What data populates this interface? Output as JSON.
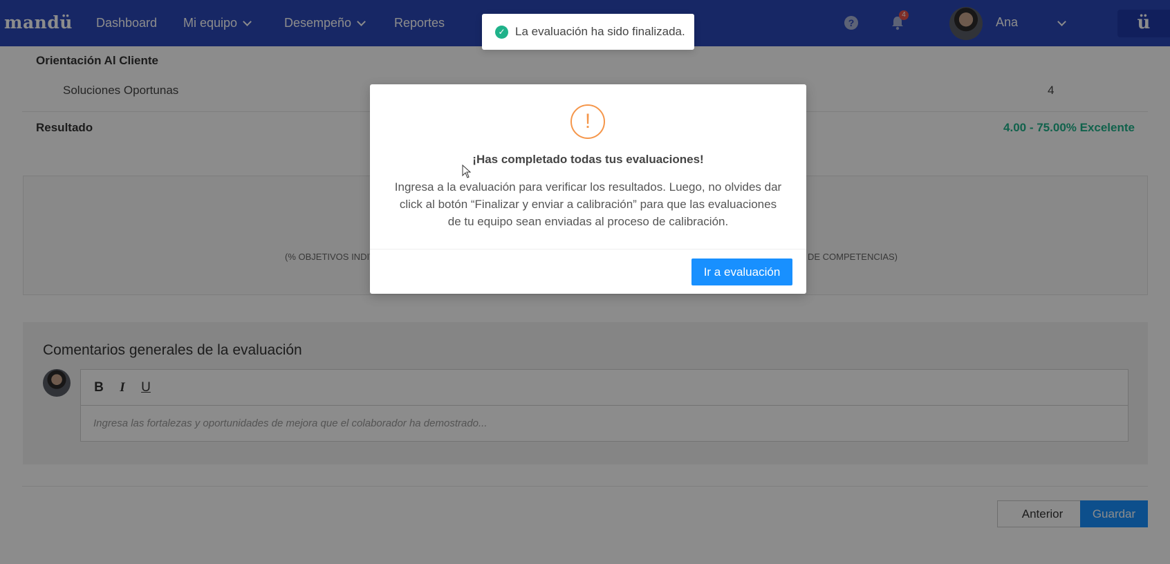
{
  "navbar": {
    "brand": "mandü",
    "items": [
      "Dashboard",
      "Mi equipo",
      "Desempeño",
      "Reportes"
    ],
    "help_icon": "question-circle-icon",
    "help_glyph": "?",
    "notifications_count": "4",
    "user_name": "Ana",
    "corner_logo": "ü"
  },
  "evaluation": {
    "section_title": "Orientación Al Cliente",
    "row_label": "Soluciones Oportunas",
    "row_score": "4",
    "result_label": "Resultado",
    "result_value": "4.00 - 75.00% Excelente",
    "summary_left": "(% OBJETIVOS INDIV",
    "summary_right": "DE COMPETENCIAS)"
  },
  "comments": {
    "title": "Comentarios generales de la evaluación",
    "toolbar": {
      "bold": "B",
      "italic": "I",
      "underline": "U"
    },
    "placeholder": "Ingresa las fortalezas y oportunidades de mejora que el colaborador ha demostrado..."
  },
  "footer": {
    "previous_label": "Anterior",
    "save_label": "Guardar"
  },
  "modal": {
    "icon_glyph": "!",
    "title": "¡Has completado todas tus evaluaciones!",
    "body": "Ingresa a la evaluación para verificar los resultados. Luego, no olvides dar click al botón “Finalizar y enviar a calibración” para que las evaluaciones de tu equipo sean enviadas al proceso de calibración.",
    "button_label": "Ir a evaluación"
  },
  "toast": {
    "icon_glyph": "✓",
    "message": "La evaluación ha sido finalizada."
  },
  "colors": {
    "navbar": "#2b48b8",
    "primary_button": "#1890ff",
    "success": "#1fb28a",
    "warning": "#f5964a"
  }
}
